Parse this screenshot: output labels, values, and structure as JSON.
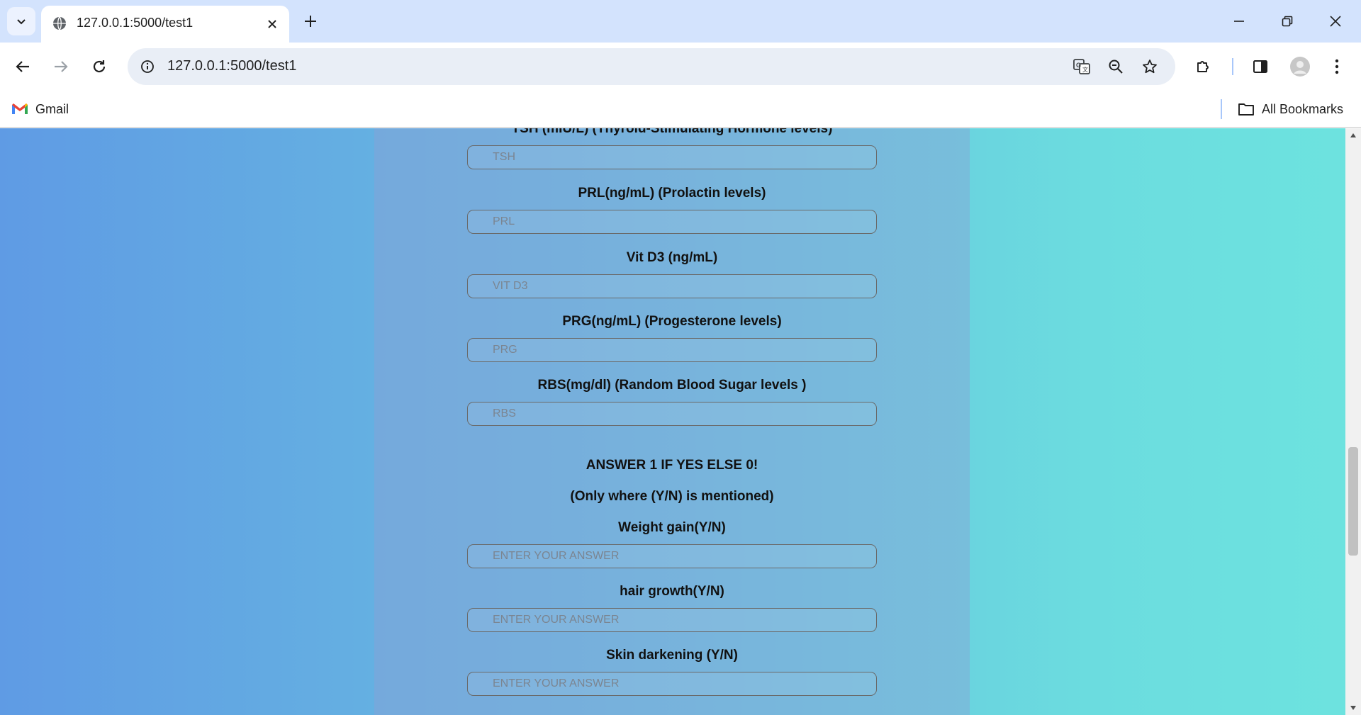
{
  "browser": {
    "tab_title": "127.0.0.1:5000/test1",
    "url": "127.0.0.1:5000/test1",
    "bookmarks": {
      "gmail": "Gmail",
      "all_bookmarks": "All Bookmarks"
    }
  },
  "form": {
    "fields": [
      {
        "label": "TSH (mIU/L) (Thyroid-Stimulating Hormone levels)",
        "placeholder": "TSH"
      },
      {
        "label": "PRL(ng/mL) (Prolactin levels)",
        "placeholder": "PRL"
      },
      {
        "label": "Vit D3 (ng/mL)",
        "placeholder": "VIT D3"
      },
      {
        "label": "PRG(ng/mL) (Progesterone levels)",
        "placeholder": "PRG"
      },
      {
        "label": "RBS(mg/dl) (Random Blood Sugar levels )",
        "placeholder": "RBS"
      }
    ],
    "instruction_heading": "ANSWER 1 IF YES ELSE 0!",
    "instruction_note": "(Only where (Y/N) is mentioned)",
    "yn_fields": [
      {
        "label": "Weight gain(Y/N)",
        "placeholder": "ENTER YOUR ANSWER"
      },
      {
        "label": "hair growth(Y/N)",
        "placeholder": "ENTER YOUR ANSWER"
      },
      {
        "label": "Skin darkening (Y/N)",
        "placeholder": "ENTER YOUR ANSWER"
      }
    ]
  },
  "colors": {
    "tab_strip": "#d3e3fd",
    "omnibox": "#e9eef6",
    "page_gradient_start": "#5f9be4",
    "page_gradient_end": "#6de3df"
  }
}
